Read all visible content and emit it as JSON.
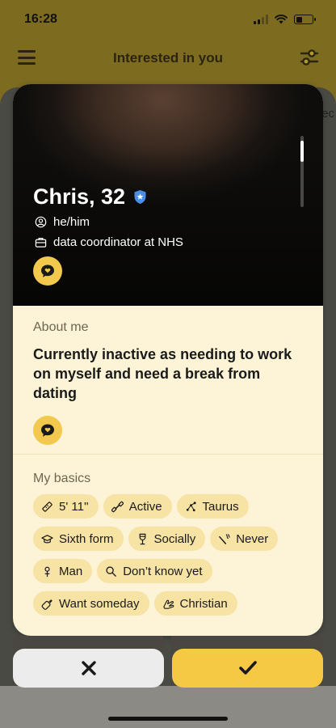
{
  "status_bar": {
    "time": "16:28"
  },
  "header": {
    "title": "Interested in you",
    "menu_icon": "hamburger-menu-icon",
    "filter_icon": "filter-sliders-icon"
  },
  "side_peek_text": "ec",
  "profile": {
    "name_age": "Chris, 32",
    "verified_icon": "verified-badge-icon",
    "pronouns": "he/him",
    "job": "data coordinator at NHS",
    "about_label": "About me",
    "about_text": "Currently inactive as needing to work on myself and need a break from dating",
    "basics_label": "My basics",
    "basics": [
      {
        "icon": "ruler-icon",
        "label": "5' 11''"
      },
      {
        "icon": "dumbbell-icon",
        "label": "Active"
      },
      {
        "icon": "zodiac-icon",
        "label": "Taurus"
      },
      {
        "icon": "graduation-cap-icon",
        "label": "Sixth form"
      },
      {
        "icon": "wine-glass-icon",
        "label": "Socially"
      },
      {
        "icon": "smoking-icon",
        "label": "Never"
      },
      {
        "icon": "gender-icon",
        "label": "Man"
      },
      {
        "icon": "search-icon",
        "label": "Don’t know yet"
      },
      {
        "icon": "baby-bottle-icon",
        "label": "Want someday"
      },
      {
        "icon": "praying-hands-icon",
        "label": "Christian"
      }
    ]
  },
  "actions": {
    "pass_icon": "close-x-icon",
    "like_icon": "checkmark-icon"
  },
  "colors": {
    "accent": "#f6c945",
    "card_background": "#fdf3d6",
    "chip_background": "#f7e3a3",
    "verified": "#4a8fe7"
  }
}
